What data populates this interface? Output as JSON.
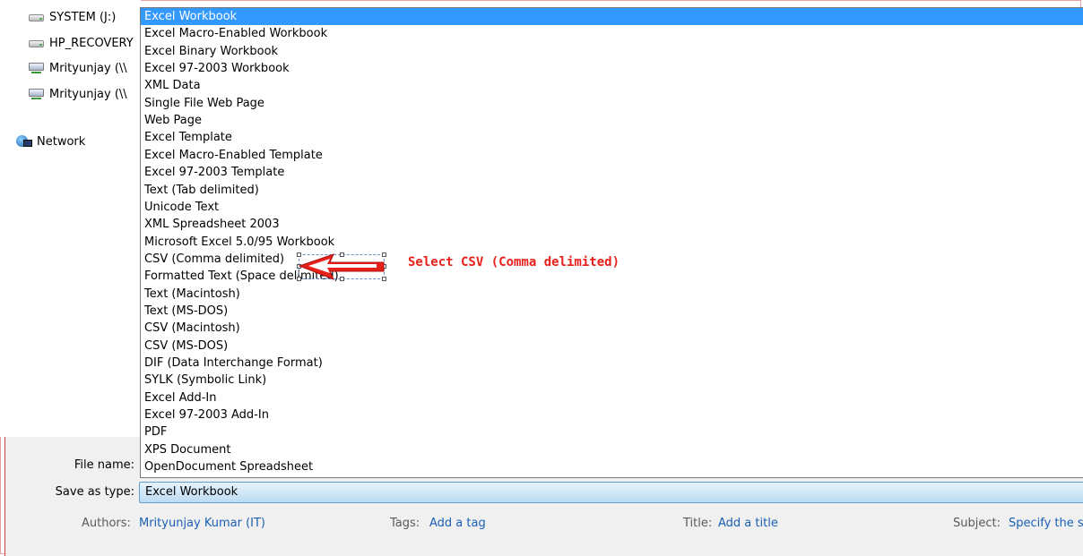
{
  "nav": {
    "items": [
      {
        "label": "SYSTEM  (J:)",
        "icon": "drive-icon"
      },
      {
        "label": "HP_RECOVERY",
        "icon": "drive-icon"
      },
      {
        "label": "Mrityunjay (\\\\",
        "icon": "network-drive-icon"
      },
      {
        "label": "Mrityunjay (\\\\",
        "icon": "network-drive-icon"
      },
      {
        "label": "Network",
        "icon": "network-icon"
      }
    ]
  },
  "dropdown": {
    "selected_index": 0,
    "options": [
      "Excel Workbook",
      "Excel Macro-Enabled Workbook",
      "Excel Binary Workbook",
      "Excel 97-2003 Workbook",
      "XML Data",
      "Single File Web Page",
      "Web Page",
      "Excel Template",
      "Excel Macro-Enabled Template",
      "Excel 97-2003 Template",
      "Text (Tab delimited)",
      "Unicode Text",
      "XML Spreadsheet 2003",
      "Microsoft Excel 5.0/95 Workbook",
      "CSV (Comma delimited)",
      "Formatted Text (Space delimited)",
      "Text (Macintosh)",
      "Text (MS-DOS)",
      "CSV (Macintosh)",
      "CSV (MS-DOS)",
      "DIF (Data Interchange Format)",
      "SYLK (Symbolic Link)",
      "Excel Add-In",
      "Excel 97-2003 Add-In",
      "PDF",
      "XPS Document",
      "OpenDocument Spreadsheet"
    ]
  },
  "annotation": {
    "text": "Select CSV (Comma delimited)",
    "color": "#e8201a"
  },
  "form": {
    "file_name_label": "File name:",
    "save_as_type_label": "Save as type:",
    "save_as_type_value": "Excel Workbook"
  },
  "meta": {
    "authors_label": "Authors:",
    "authors_value": "Mrityunjay Kumar (IT)",
    "tags_label": "Tags:",
    "tags_value": "Add a tag",
    "title_label": "Title:",
    "title_value": "Add a title",
    "subject_label": "Subject:",
    "subject_value": "Specify the s"
  },
  "colors": {
    "selection": "#3399ff",
    "link": "#1a5fb4"
  }
}
